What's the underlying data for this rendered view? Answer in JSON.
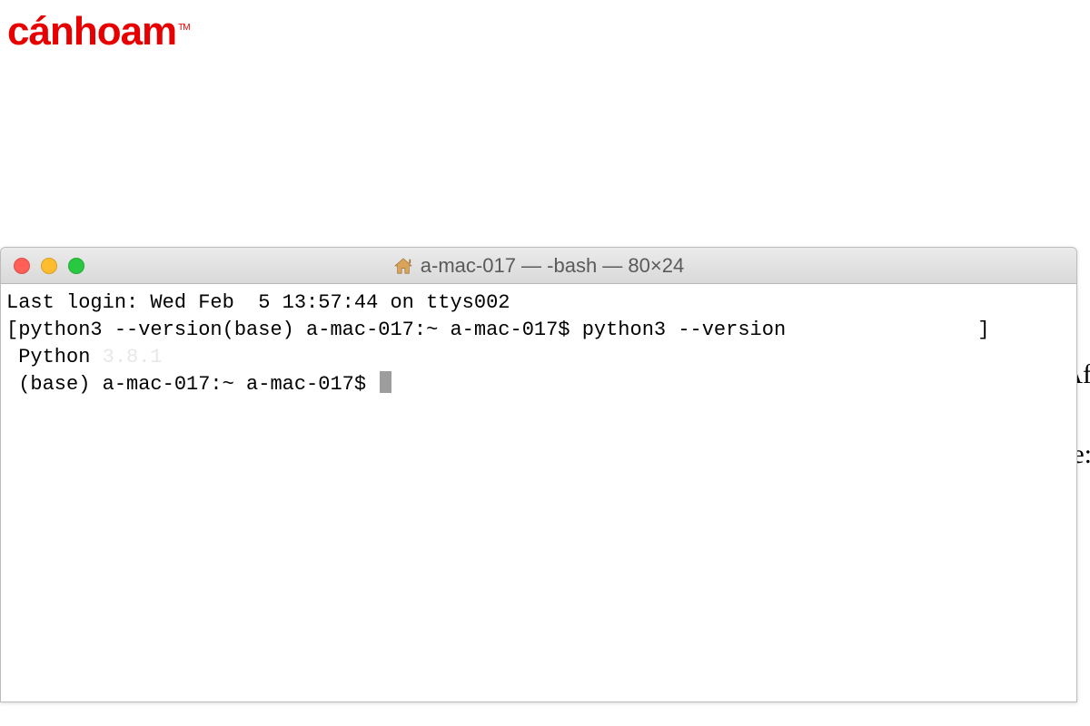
{
  "logo": {
    "text": "cánhoam",
    "tm": "TM"
  },
  "window": {
    "title": "a-mac-017 — -bash — 80×24",
    "home_icon": "home-icon"
  },
  "terminal": {
    "line1": "Last login: Wed Feb  5 13:57:44 on ttys002",
    "line2_left": "[python3 --version(base) a-mac-017:~ a-mac-017$ ",
    "line2_cmd": "python3 --version",
    "line2_right": "                ]",
    "line3_prefix": " Python ",
    "line3_version": "3.8.1",
    "line4_prompt": " (base) a-mac-017:~ a-mac-017$ "
  },
  "bg": {
    "frag1": "Af",
    "frag2": "e:"
  }
}
